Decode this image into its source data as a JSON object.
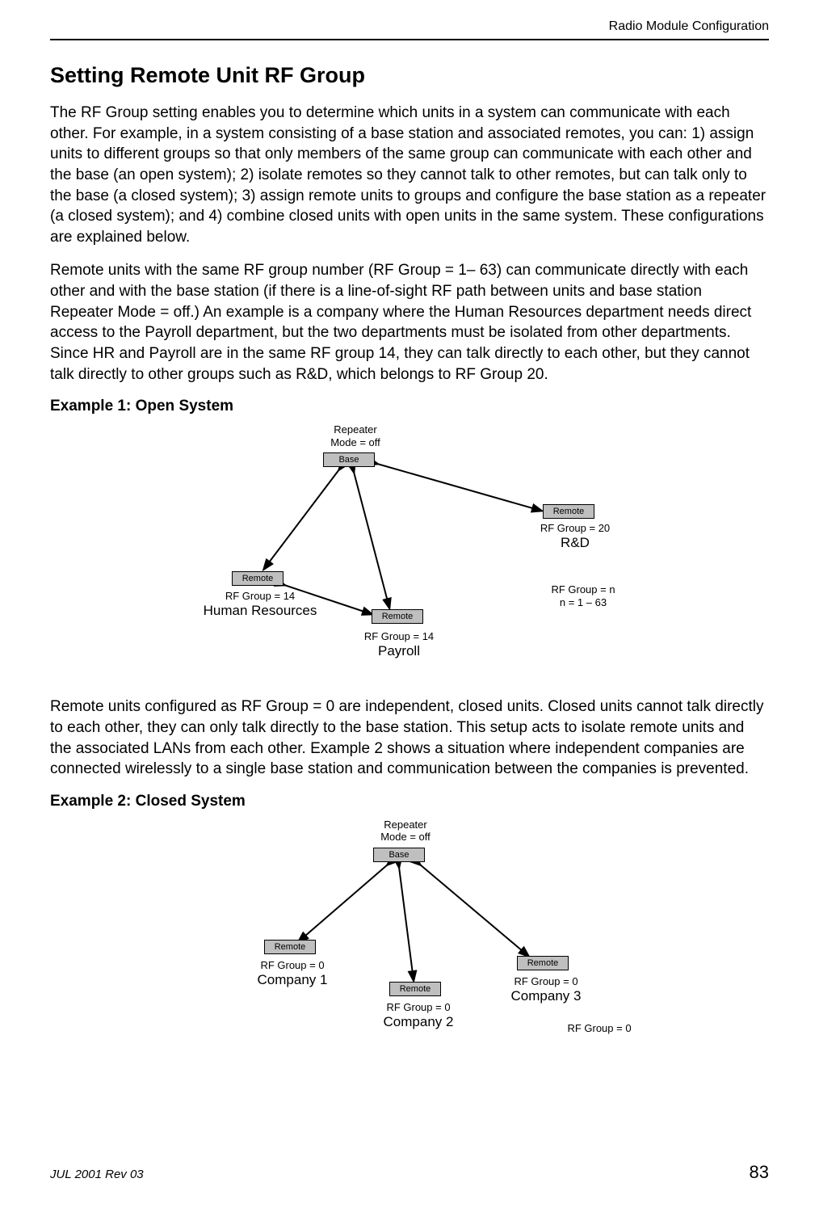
{
  "header": {
    "section": "Radio Module Configuration"
  },
  "title": "Setting Remote Unit RF Group",
  "para1": "The RF Group setting enables you to determine which units in a system can communicate with each other. For example, in a system consisting of a base station and associated remotes, you can: 1) assign units to different groups so that only members of the same group can communicate with each other and the base (an open system); 2) isolate remotes so they cannot talk to other remotes, but can talk only to the base (a closed system); 3) assign remote units to groups and configure the base station as a repeater (a closed system); and 4) combine closed units with open units in the same system.  These configurations are explained below.",
  "para2": "Remote units with the same RF group number (RF Group = 1– 63) can communicate directly with each other and with the base station (if there is a line-of-sight RF path between units and base station Repeater Mode = off.) An example is a company where the Human Resources department needs direct access to the Payroll department, but the two departments must be isolated from other departments. Since HR and Payroll are in the same RF group 14, they can talk directly to each other, but they cannot talk directly to other groups such as R&D, which belongs to RF Group 20.",
  "example1": {
    "heading": "Example 1: Open System",
    "repeater_label_l1": "Repeater",
    "repeater_label_l2": "Mode = off",
    "base_label": "Base",
    "remote_label": "Remote",
    "hr_group": "RF Group = 14",
    "hr_name": "Human Resources",
    "payroll_group": "RF Group = 14",
    "payroll_name": "Payroll",
    "rd_group": "RF Group = 20",
    "rd_name": "R&D",
    "legend_l1": "RF Group = n",
    "legend_l2": "n = 1 – 63"
  },
  "para3": "Remote units configured as RF Group = 0 are independent, closed units. Closed units cannot talk directly to each other, they can only talk directly to the base station. This setup acts to isolate remote units and the associated LANs from each other. Example 2 shows a situation where independent companies are connected wirelessly to a single base station and communication between the companies is prevented.",
  "example2": {
    "heading": "Example 2: Closed System",
    "repeater_label_l1": "Repeater",
    "repeater_label_l2": "Mode = off",
    "base_label": "Base",
    "remote_label": "Remote",
    "c1_group": "RF Group = 0",
    "c1_name": "Company 1",
    "c2_group": "RF Group = 0",
    "c2_name": "Company 2",
    "c3_group": "RF Group = 0",
    "c3_name": "Company 3",
    "legend": "RF Group = 0"
  },
  "footer": {
    "left": "JUL 2001 Rev 03",
    "right": "83"
  }
}
